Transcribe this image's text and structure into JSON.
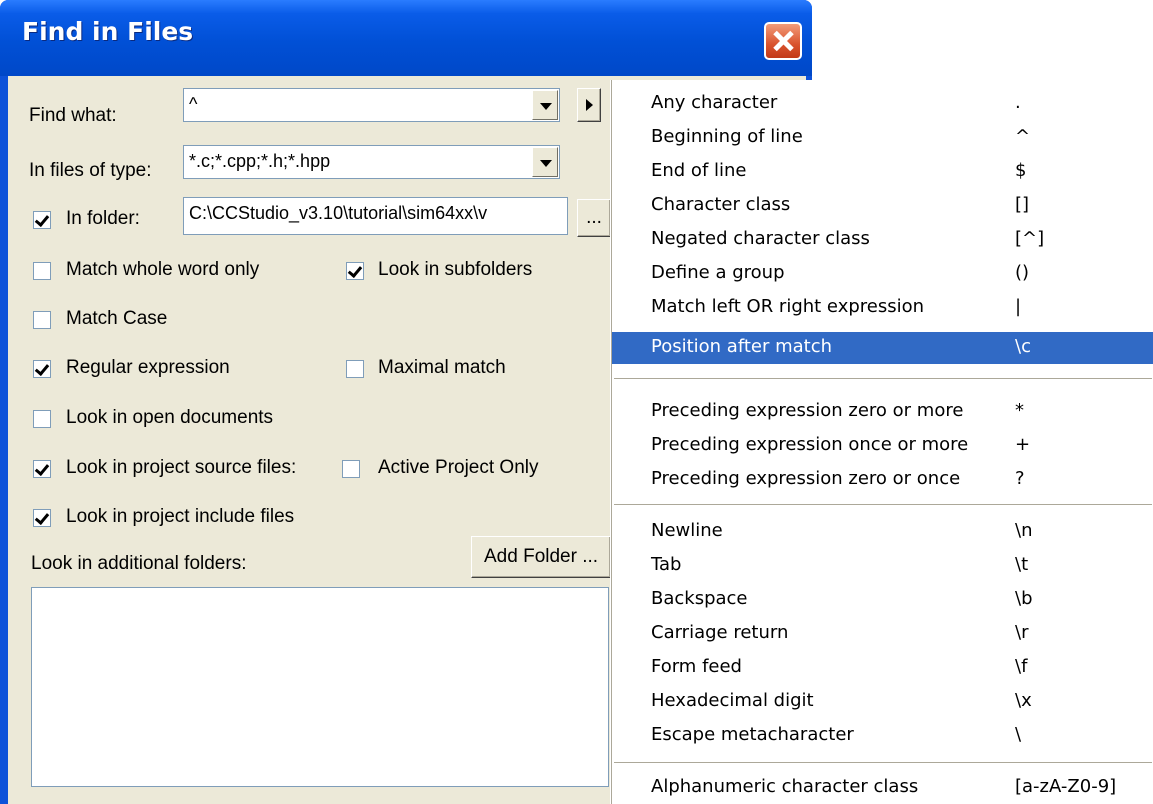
{
  "window": {
    "title": "Find in Files"
  },
  "find_what": {
    "label": "Find what:",
    "value": "^"
  },
  "files_of_type": {
    "label": "In files of type:",
    "value": "*.c;*.cpp;*.h;*.hpp"
  },
  "in_folder": {
    "label": "In folder:",
    "checked": true,
    "value": "C:\\CCStudio_v3.10\\tutorial\\sim64xx\\v",
    "browse_label": "..."
  },
  "options": {
    "match_whole_word": {
      "label": "Match whole word only",
      "checked": false
    },
    "look_in_subfolders": {
      "label": "Look in subfolders",
      "checked": true
    },
    "match_case": {
      "label": "Match Case",
      "checked": false
    },
    "regular_expression": {
      "label": "Regular expression",
      "checked": true
    },
    "maximal_match": {
      "label": "Maximal match",
      "checked": false
    },
    "look_in_open_documents": {
      "label": "Look in open documents",
      "checked": false
    },
    "look_in_project_source": {
      "label": "Look in project source files:",
      "checked": true
    },
    "active_project_only": {
      "label": "Active Project Only",
      "checked": false
    },
    "look_in_project_include": {
      "label": "Look in project include files",
      "checked": true
    }
  },
  "additional_folders": {
    "label": "Look in additional folders:",
    "add_button": "Add Folder ..."
  },
  "regex_menu": {
    "items": [
      {
        "label": "Any character",
        "symbol": "."
      },
      {
        "label": "Beginning of line",
        "symbol": "^"
      },
      {
        "label": "End of line",
        "symbol": "$"
      },
      {
        "label": "Character class",
        "symbol": "[]"
      },
      {
        "label": "Negated character class",
        "symbol": "[^]"
      },
      {
        "label": "Define a group",
        "symbol": "()"
      },
      {
        "label": "Match left OR right expression",
        "symbol": "|"
      },
      {
        "label": "Position after match",
        "symbol": "\\c"
      },
      {
        "label": "Preceding expression zero or more",
        "symbol": "*"
      },
      {
        "label": "Preceding expression once or more",
        "symbol": "+"
      },
      {
        "label": "Preceding expression zero or once",
        "symbol": "?"
      },
      {
        "label": "Newline",
        "symbol": "\\n"
      },
      {
        "label": "Tab",
        "symbol": "\\t"
      },
      {
        "label": "Backspace",
        "symbol": "\\b"
      },
      {
        "label": "Carriage return",
        "symbol": "\\r"
      },
      {
        "label": "Form feed",
        "symbol": "\\f"
      },
      {
        "label": "Hexadecimal digit",
        "symbol": "\\x"
      },
      {
        "label": "Escape metacharacter",
        "symbol": "\\"
      },
      {
        "label": "Alphanumeric character class",
        "symbol": "[a-zA-Z0-9]"
      }
    ],
    "highlighted": "Position after match"
  },
  "colors": {
    "title_bar": "#0054e3",
    "dialog_bg": "#ece9d8",
    "highlight": "#316ac5"
  }
}
